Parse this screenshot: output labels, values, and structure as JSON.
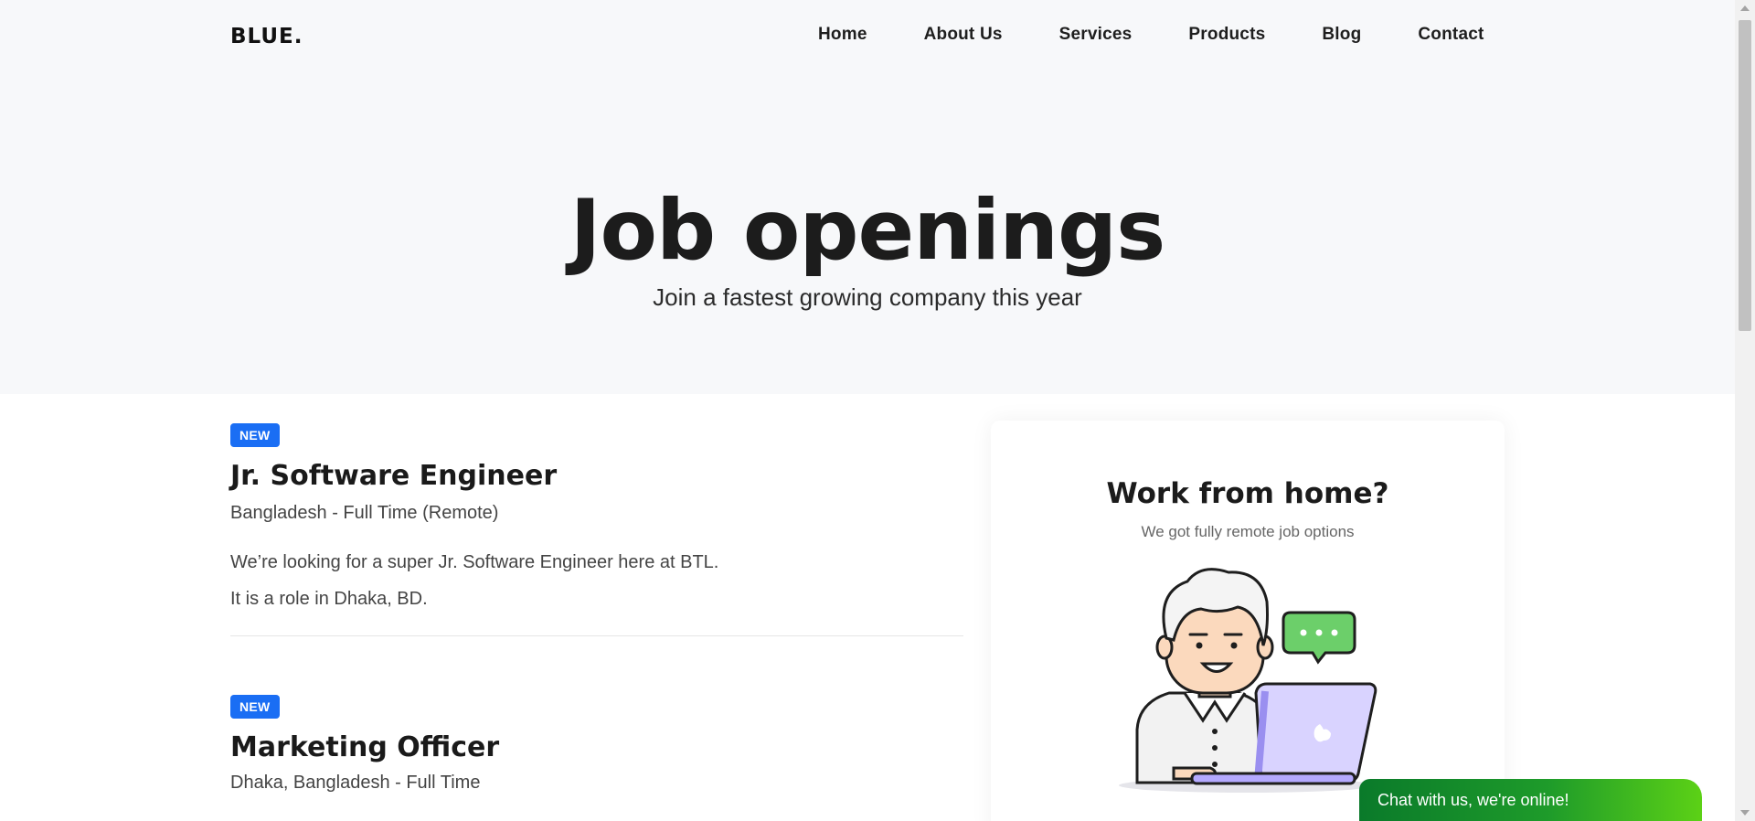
{
  "header": {
    "logo": "BLUE.",
    "nav": [
      "Home",
      "About Us",
      "Services",
      "Products",
      "Blog",
      "Contact"
    ]
  },
  "hero": {
    "title": "Job openings",
    "subtitle": "Join a fastest growing company this year"
  },
  "jobs": [
    {
      "badge": "NEW",
      "title": "Jr. Software Engineer",
      "meta": "Bangladesh - Full Time (Remote)",
      "desc": [
        "We’re looking for a super Jr. Software Engineer here at BTL.",
        "It is a role in Dhaka, BD."
      ]
    },
    {
      "badge": "NEW",
      "title": "Marketing Officer",
      "meta": "Dhaka, Bangladesh - Full Time"
    }
  ],
  "sidebar_card": {
    "title": "Work from home?",
    "subtitle": "We got fully remote job options"
  },
  "chat_widget": {
    "label": "Chat with us, we're online!"
  },
  "colors": {
    "accent": "#1a6ef4",
    "hero_bg": "#f7f8fa",
    "chat_green": "#1e9b2a"
  }
}
